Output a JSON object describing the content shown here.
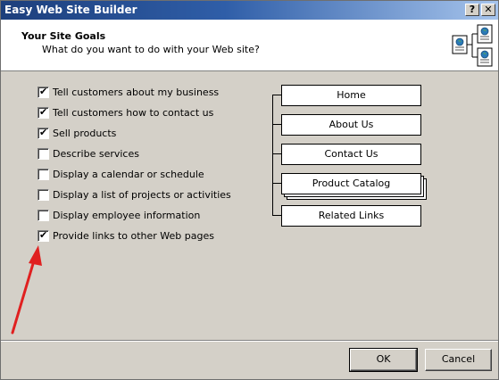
{
  "window": {
    "title": "Easy Web Site Builder",
    "help_label": "?",
    "close_label": "✕"
  },
  "header": {
    "title": "Your Site Goals",
    "subtitle": "What do you want to do with your Web site?",
    "icon": "site-pages-icon"
  },
  "goals": [
    {
      "label": "Tell customers about my business",
      "checked": true
    },
    {
      "label": "Tell customers how to contact us",
      "checked": true
    },
    {
      "label": "Sell products",
      "checked": true
    },
    {
      "label": "Describe services",
      "checked": false
    },
    {
      "label": "Display a calendar or schedule",
      "checked": false
    },
    {
      "label": "Display a list of projects or activities",
      "checked": false
    },
    {
      "label": "Display employee information",
      "checked": false
    },
    {
      "label": "Provide links to other Web pages",
      "checked": true
    }
  ],
  "site_map": {
    "pages": [
      {
        "label": "Home",
        "stacked": false
      },
      {
        "label": "About Us",
        "stacked": false
      },
      {
        "label": "Contact Us",
        "stacked": false
      },
      {
        "label": "Product Catalog",
        "stacked": true
      },
      {
        "label": "Related Links",
        "stacked": false
      }
    ]
  },
  "buttons": {
    "ok_label": "OK",
    "cancel_label": "Cancel"
  },
  "annotation": {
    "color": "#e02020"
  }
}
